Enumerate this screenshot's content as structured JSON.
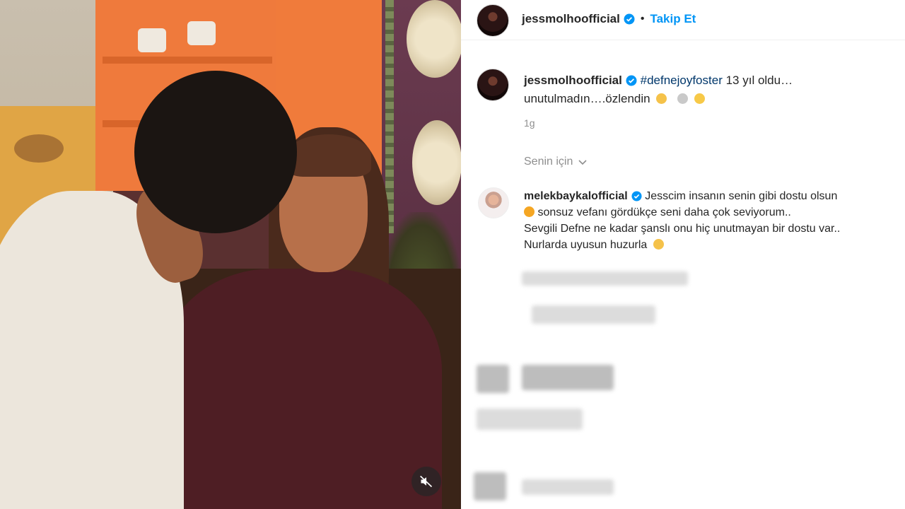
{
  "post": {
    "author": "jessmolhoofficial",
    "follow_label": "Takip Et",
    "dot": "•",
    "caption": {
      "hashtag": "#defnejoyfoster",
      "text_line1": " 13 yıl oldu…",
      "text_line2": "unutulmadın….özlendin"
    },
    "time": "1g",
    "for_you_label": "Senin için"
  },
  "comment": {
    "author": "melekbaykalofficial",
    "line1": " Jesscim insanın senin gibi dostu olsun",
    "line2": " sonsuz vefanı gördükçe seni daha çok seviyorum..",
    "line3": "Sevgili Defne ne kadar şanslı onu hiç unutmayan bir dostu var..",
    "line4": "Nurlarda uyusun huzurla"
  },
  "icons": {
    "verified": "verified-badge-icon",
    "mute": "speaker-muted-icon",
    "chevron": "chevron-down-icon"
  },
  "colors": {
    "link_blue": "#0095f6",
    "hashtag": "#00376b",
    "secondary_text": "#8e8e8e"
  }
}
